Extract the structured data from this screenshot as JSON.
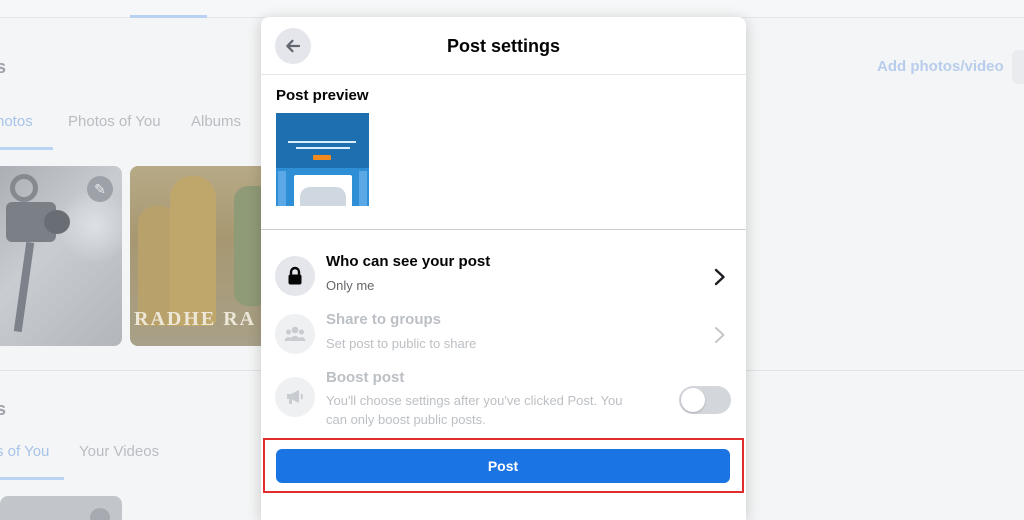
{
  "background": {
    "section_heading_1": "s",
    "section_heading_2": "s",
    "add_photos_label": "Add photos/video",
    "tabs_row_1": [
      "hotos",
      "Photos of You",
      "Albums"
    ],
    "tabs_row_2": [
      "s of You",
      "Your Videos"
    ],
    "thumb_overlay_text": "RADHE RA"
  },
  "modal": {
    "title": "Post settings",
    "back_icon": "arrow-left-icon",
    "preview_label": "Post preview",
    "settings": [
      {
        "icon": "lock-icon",
        "title": "Who can see your post",
        "subtitle": "Only me",
        "enabled": true
      },
      {
        "icon": "groups-icon",
        "title": "Share to groups",
        "subtitle": "Set post to public to share",
        "enabled": false
      },
      {
        "icon": "megaphone-icon",
        "title": "Boost post",
        "subtitle_line1": "You'll choose settings after you've clicked Post. You",
        "subtitle_line2": "can only boost public posts.",
        "enabled": false,
        "toggle_on": false
      }
    ],
    "post_button_label": "Post"
  },
  "colors": {
    "accent": "#1b74e4",
    "highlight_border": "#e32d2d",
    "disabled_text": "#bcc0c4"
  }
}
